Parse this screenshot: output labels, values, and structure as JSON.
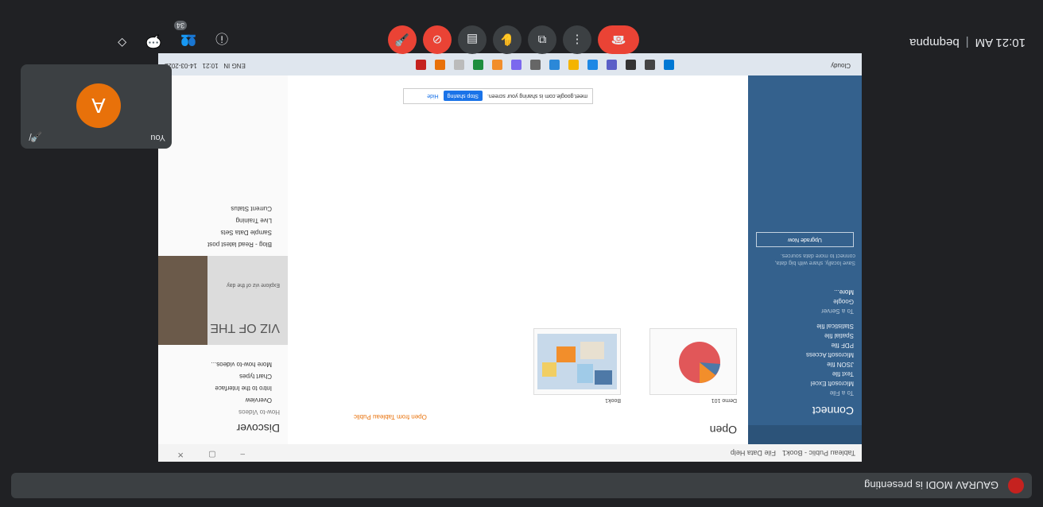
{
  "meeting": {
    "time": "10:21 AM",
    "code": "beqmpna",
    "presenter_banner": "GAURAV MODI is presenting",
    "self": {
      "label": "You",
      "initial": "A"
    },
    "participant_count": "34",
    "colors": {
      "end_call": "#ea4335",
      "avatar": "#e8710a",
      "background": "#202124"
    }
  },
  "tableau": {
    "title": "Tableau Public - Book1",
    "menu": "File  Data  Help",
    "connect": {
      "heading": "Connect",
      "to_a_file": "To a File",
      "items": [
        "Microsoft Excel",
        "Text file",
        "JSON file",
        "Microsoft Access",
        "PDF file",
        "Spatial file",
        "Statistical file"
      ],
      "to_a_server": "To a Server",
      "server_items": [
        "Google",
        "More..."
      ],
      "hint": "Save locally, share with big data, connect to more data sources.",
      "upgrade": "Upgrade Now"
    },
    "open": {
      "heading": "Open",
      "sample_link": "Open from Tableau Public",
      "thumbs": [
        {
          "caption": "Demo 101"
        },
        {
          "caption": "Book1"
        }
      ]
    },
    "discover": {
      "heading": "Discover",
      "how_to": "How-to Videos",
      "links": [
        "Overview",
        "Intro to the Interface",
        "Chart types",
        "More how-to videos..."
      ],
      "viz_title": "VIZ OF THE DAY",
      "viz_sub": "Explore viz of the day",
      "blog_links": [
        "Blog - Read latest post",
        "Sample Data Sets",
        "Live Training",
        "Current Status"
      ]
    },
    "share_banner": {
      "message": "meet.google.com is sharing your screen.",
      "stop": "Stop sharing",
      "hide": "Hide"
    },
    "taskbar": {
      "weather": "Cloudy",
      "lang": "ENG IN",
      "clock": "10:21",
      "date": "14-03-2022"
    }
  }
}
